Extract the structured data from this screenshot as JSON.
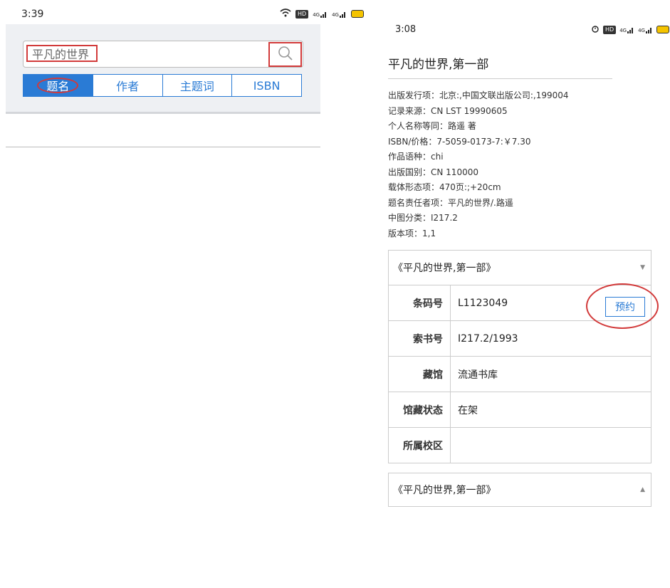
{
  "left_screen": {
    "status_time": "3:39",
    "status_icons": [
      "wifi-icon",
      "hd-icon",
      "signal-4g-icon",
      "signal-4g-icon",
      "battery-icon"
    ],
    "status_labels": {
      "hd": "HD",
      "sig1": "4G",
      "sig2": "4G"
    },
    "search": {
      "value": "平凡的世界",
      "button_icon": "search-icon"
    },
    "tabs": [
      {
        "label": "题名",
        "active": true
      },
      {
        "label": "作者",
        "active": false
      },
      {
        "label": "主题词",
        "active": false
      },
      {
        "label": "ISBN",
        "active": false
      }
    ]
  },
  "right_screen": {
    "status_time": "3:08",
    "status_labels": {
      "hd": "HD",
      "sig1": "4G",
      "sig2": "4G"
    },
    "title": "平凡的世界,第一部",
    "meta": [
      "出版发行项：北京:,中国文联出版公司:,199004",
      "记录来源：CN LST 19990605",
      "个人名称等同：路遥 著",
      "ISBN/价格：7-5059-0173-7:￥7.30",
      "作品语种：chi",
      "出版国别：CN 110000",
      "载体形态项：470页:;+20cm",
      "题名责任者项：平凡的世界/.路遥",
      "中图分类：I217.2",
      "版本项：1,1"
    ],
    "holding_header": "《平凡的世界,第一部》",
    "holdings": [
      {
        "key": "条码号",
        "value": "L1123049"
      },
      {
        "key": "索书号",
        "value": "I217.2/1993"
      },
      {
        "key": "藏馆",
        "value": "流通书库"
      },
      {
        "key": "馆藏状态",
        "value": "在架"
      },
      {
        "key": "所属校区",
        "value": ""
      }
    ],
    "reserve_label": "预约",
    "holding_header_2": "《平凡的世界,第一部》",
    "colors": {
      "accent": "#2a7bd5",
      "annotation": "#d23a3a"
    }
  }
}
